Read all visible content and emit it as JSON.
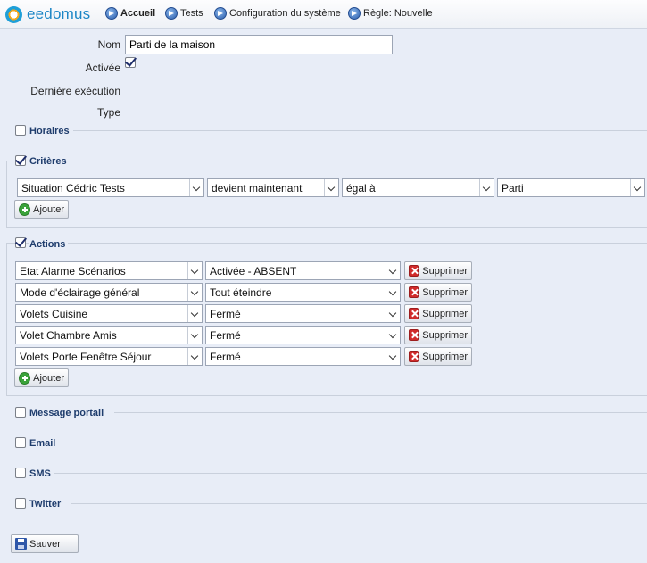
{
  "app": {
    "logo_text": "eedomus"
  },
  "nav": [
    {
      "label": "Accueil",
      "bold": true
    },
    {
      "label": "Tests"
    },
    {
      "label": "Configuration du système"
    },
    {
      "label": "Règle: Nouvelle"
    }
  ],
  "form": {
    "nom_label": "Nom",
    "nom_value": "Parti de la maison",
    "activee_label": "Activée",
    "activee_checked": true,
    "derniere_label": "Dernière exécution",
    "type_label": "Type"
  },
  "sections": {
    "horaires": {
      "label": "Horaires",
      "checked": false
    },
    "criteres": {
      "label": "Critères",
      "checked": true
    },
    "actions": {
      "label": "Actions",
      "checked": true
    },
    "message": {
      "label": "Message portail",
      "checked": false
    },
    "email": {
      "label": "Email",
      "checked": false
    },
    "sms": {
      "label": "SMS",
      "checked": false
    },
    "twitter": {
      "label": "Twitter",
      "checked": false
    }
  },
  "criteres_row": {
    "device": "Situation Cédric Tests",
    "change": "devient maintenant",
    "operator": "égal à",
    "value": "Parti"
  },
  "actions_rows": [
    {
      "device": "Etat Alarme Scénarios",
      "value": "Activée - ABSENT"
    },
    {
      "device": "Mode d'éclairage général",
      "value": "Tout éteindre"
    },
    {
      "device": "Volets Cuisine",
      "value": "Fermé"
    },
    {
      "device": "Volet Chambre Amis",
      "value": "Fermé"
    },
    {
      "device": "Volets Porte Fenêtre Séjour",
      "value": "Fermé"
    }
  ],
  "buttons": {
    "ajouter": "Ajouter",
    "supprimer": "Supprimer",
    "sauver": "Sauver"
  }
}
